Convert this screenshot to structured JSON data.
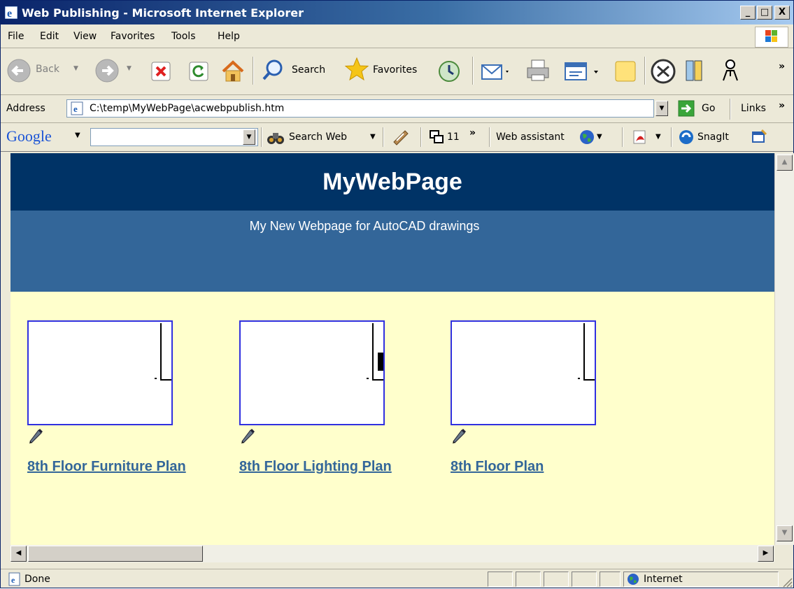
{
  "window": {
    "title": "Web Publishing - Microsoft Internet Explorer",
    "minimize": "_",
    "maximize": "□",
    "close": "X"
  },
  "menu": [
    "File",
    "Edit",
    "View",
    "Favorites",
    "Tools",
    "Help"
  ],
  "toolbar": {
    "back_label": "Back",
    "search_label": "Search",
    "favorites_label": "Favorites",
    "more": "»"
  },
  "address": {
    "label": "Address",
    "value": "C:\\temp\\MyWebPage\\acwebpublish.htm",
    "go_label": "Go",
    "links_label": "Links",
    "more": "»"
  },
  "google_toolbar": {
    "logo": "Google",
    "search_web_label": "Search Web",
    "popup_count": "11",
    "more": "»",
    "web_assistant_label": "Web assistant",
    "snagit_label": "SnagIt"
  },
  "page": {
    "title": "MyWebPage",
    "subtitle": "My New Webpage for AutoCAD drawings",
    "drawings": [
      {
        "label": "8th Floor Furniture Plan"
      },
      {
        "label": "8th Floor Lighting Plan"
      },
      {
        "label": "8th Floor Plan"
      }
    ]
  },
  "status": {
    "text": "Done",
    "zone": "Internet"
  },
  "colors": {
    "banner": "#003366",
    "subband": "#336699",
    "page_bg": "#ffffcc",
    "link": "#336699"
  }
}
